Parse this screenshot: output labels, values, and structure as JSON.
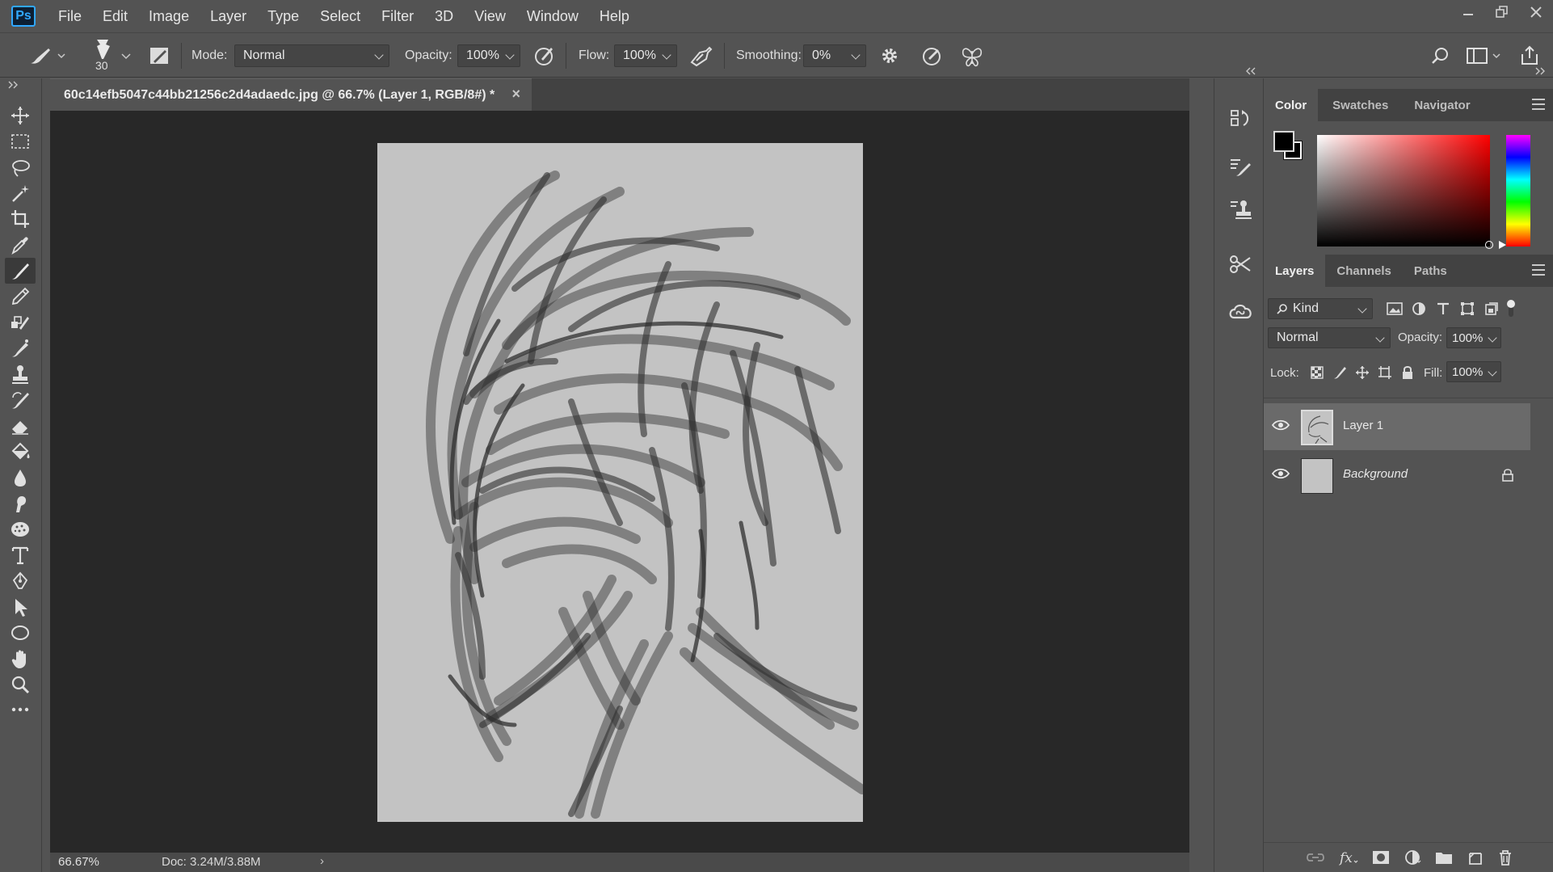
{
  "app": {
    "logo": "Ps",
    "menus": [
      "File",
      "Edit",
      "Image",
      "Layer",
      "Type",
      "Select",
      "Filter",
      "3D",
      "View",
      "Window",
      "Help"
    ],
    "window_controls": [
      "minimize-icon",
      "restore-icon",
      "close-icon"
    ]
  },
  "options": {
    "brush_size": "30",
    "mode_label": "Mode:",
    "mode_value": "Normal",
    "opacity_label": "Opacity:",
    "opacity_value": "100%",
    "flow_label": "Flow:",
    "flow_value": "100%",
    "smoothing_label": "Smoothing:",
    "smoothing_value": "0%"
  },
  "document": {
    "tab_title": "60c14efb5047c44bb21256c2d4adaedc.jpg @ 66.7% (Layer 1, RGB/8#) *",
    "close": "×",
    "zoom": "66.67%",
    "doc_info": "Doc: 3.24M/3.88M",
    "status_arrow": "›"
  },
  "tools": [
    "move-tool-icon",
    "marquee-tool-icon",
    "lasso-tool-icon",
    "magic-wand-icon",
    "crop-tool-icon",
    "eyedropper-icon",
    "brush-tool-icon",
    "pencil-tool-icon",
    "color-replacement-icon",
    "mixer-brush-icon",
    "stamp-tool-icon",
    "history-brush-icon",
    "eraser-tool-icon",
    "paint-bucket-icon",
    "blur-tool-icon",
    "smudge-tool-icon",
    "sponge-tool-icon",
    "type-tool-icon",
    "pen-tool-icon",
    "path-selection-icon",
    "ellipse-tool-icon",
    "hand-tool-icon",
    "zoom-tool-icon",
    "more-tools-icon"
  ],
  "color_panel": {
    "tabs": [
      "Color",
      "Swatches",
      "Navigator"
    ],
    "active_tab": "Color",
    "foreground": "#000000",
    "background": "#ffffff",
    "hue": "#ff0000"
  },
  "layers_panel": {
    "tabs": [
      "Layers",
      "Channels",
      "Paths"
    ],
    "active_tab": "Layers",
    "filter_label": "Kind",
    "blend_mode": "Normal",
    "opacity_label": "Opacity:",
    "opacity_value": "100%",
    "lock_label": "Lock:",
    "fill_label": "Fill:",
    "fill_value": "100%",
    "layers": [
      {
        "name": "Layer 1",
        "selected": true,
        "visible": true
      },
      {
        "name": "Background",
        "selected": false,
        "visible": true,
        "locked": true
      }
    ]
  }
}
